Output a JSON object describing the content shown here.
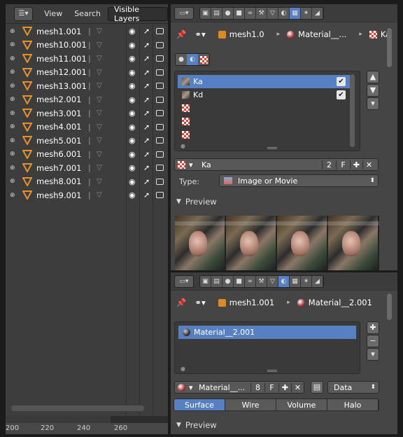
{
  "outliner": {
    "menu_view": "View",
    "menu_search": "Search",
    "display_mode": "Visible Layers",
    "objects": [
      "mesh1.001",
      "mesh10.001",
      "mesh11.001",
      "mesh12.001",
      "mesh13.001",
      "mesh2.001",
      "mesh3.001",
      "mesh4.001",
      "mesh5.001",
      "mesh6.001",
      "mesh7.001",
      "mesh8.001",
      "mesh9.001"
    ]
  },
  "timeline": {
    "ticks": [
      "200",
      "220",
      "240",
      "260"
    ]
  },
  "texture_panel": {
    "breadcrumb": {
      "object": "mesh1.0",
      "material": "Material__...",
      "texture": "Ka"
    },
    "slots": [
      {
        "name": "Ka",
        "checked": true
      },
      {
        "name": "Kd",
        "checked": true
      },
      {
        "name": ""
      },
      {
        "name": ""
      },
      {
        "name": ""
      }
    ],
    "datablock_name": "Ka",
    "users": "2",
    "fake_user": "F",
    "type_label": "Type:",
    "type_value": "Image or Movie",
    "preview_title": "Preview"
  },
  "material_panel": {
    "breadcrumb": {
      "object": "mesh1.001",
      "material": "Material__2.001"
    },
    "slot_name": "Material__2.001",
    "datablock_name": "Material__...",
    "users": "8",
    "fake_user": "F",
    "link": "Data",
    "tabs": [
      "Surface",
      "Wire",
      "Volume",
      "Halo"
    ],
    "active_tab": "Surface",
    "preview_title": "Preview"
  },
  "colors": {
    "accent": "#5680c2",
    "panel": "#454545",
    "outliner": "#3d3d3d"
  }
}
